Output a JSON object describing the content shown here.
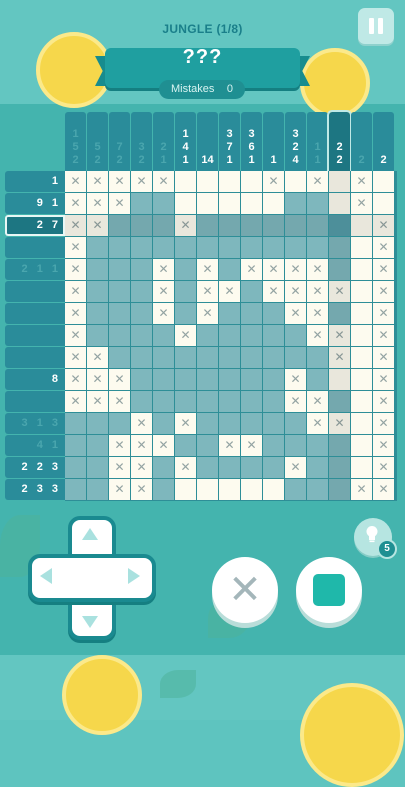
{
  "header": {
    "level_title": "JUNGLE (1/8)",
    "puzzle_name": "???",
    "mistakes_label": "Mistakes",
    "mistakes_value": "0",
    "pause_icon": "pause-icon"
  },
  "colors": {
    "background": "#5ec4bf",
    "clue_bg": "#2a8c9a",
    "filled": "#7eb7bd",
    "empty": "#fdfbef",
    "fill_button": "#1fb8aa"
  },
  "board": {
    "size": 15,
    "selected_row": 2,
    "selected_col": 12,
    "column_clues": [
      {
        "numbers": [
          "1",
          "5",
          "2"
        ],
        "bright": false
      },
      {
        "numbers": [
          "5",
          "2"
        ],
        "bright": false
      },
      {
        "numbers": [
          "7",
          "2"
        ],
        "bright": false
      },
      {
        "numbers": [
          "3",
          "2"
        ],
        "bright": false
      },
      {
        "numbers": [
          "2",
          "1"
        ],
        "bright": false
      },
      {
        "numbers": [
          "1",
          "4",
          "1"
        ],
        "bright": true
      },
      {
        "numbers": [
          "14"
        ],
        "bright": true
      },
      {
        "numbers": [
          "3",
          "7",
          "1"
        ],
        "bright": true
      },
      {
        "numbers": [
          "3",
          "6",
          "1"
        ],
        "bright": true
      },
      {
        "numbers": [
          "1"
        ],
        "bright": true
      },
      {
        "numbers": [
          "3",
          "2",
          "4"
        ],
        "bright": true
      },
      {
        "numbers": [
          "1",
          "1"
        ],
        "bright": false
      },
      {
        "numbers": [
          "2",
          "2"
        ],
        "bright": true
      },
      {
        "numbers": [
          "2"
        ],
        "bright": false
      },
      {
        "numbers": [
          "2"
        ],
        "bright": true
      }
    ],
    "row_clues": [
      {
        "text": "1",
        "bright": true
      },
      {
        "text": "9 1",
        "bright": true
      },
      {
        "text": "2 7",
        "bright": true
      },
      {
        "text": "",
        "bright": false
      },
      {
        "text": "2 1 1",
        "bright": false
      },
      {
        "text": "",
        "bright": false
      },
      {
        "text": "",
        "bright": false
      },
      {
        "text": "",
        "bright": false
      },
      {
        "text": "",
        "bright": false
      },
      {
        "text": "8",
        "bright": true
      },
      {
        "text": "",
        "bright": false
      },
      {
        "text": "3 1 3",
        "bright": false
      },
      {
        "text": "4 1",
        "bright": false
      },
      {
        "text": "2 2 3",
        "bright": true
      },
      {
        "text": "2 3 3",
        "bright": true
      }
    ],
    "cells": [
      "xxxxx....x.x.x.",
      "xxxff.....ff.x.",
      "xxfffxfffffff.x",
      "xffffffffffff.x",
      "xfffxfxfxxxxf.x",
      "xfffxfxxfxxxx.x",
      "xfffxfxfffxxf.x",
      "xffffxfffffxx.x",
      "xxffffffffffx.x",
      "xxxfffffffxf..x",
      "xxxfffffffxxf.x",
      "fffxfxfffffxx.x",
      "ffxxxffxxffff.x",
      "ffxxfxffffxff.x",
      "ffxxf.....fffxx"
    ]
  },
  "controls": {
    "dpad_icon": "dpad-icon",
    "cross_icon": "cross-icon",
    "cross_symbol": "✕",
    "fill_icon": "fill-square-icon",
    "hint_icon": "lightbulb-icon",
    "hint_count": "5"
  }
}
